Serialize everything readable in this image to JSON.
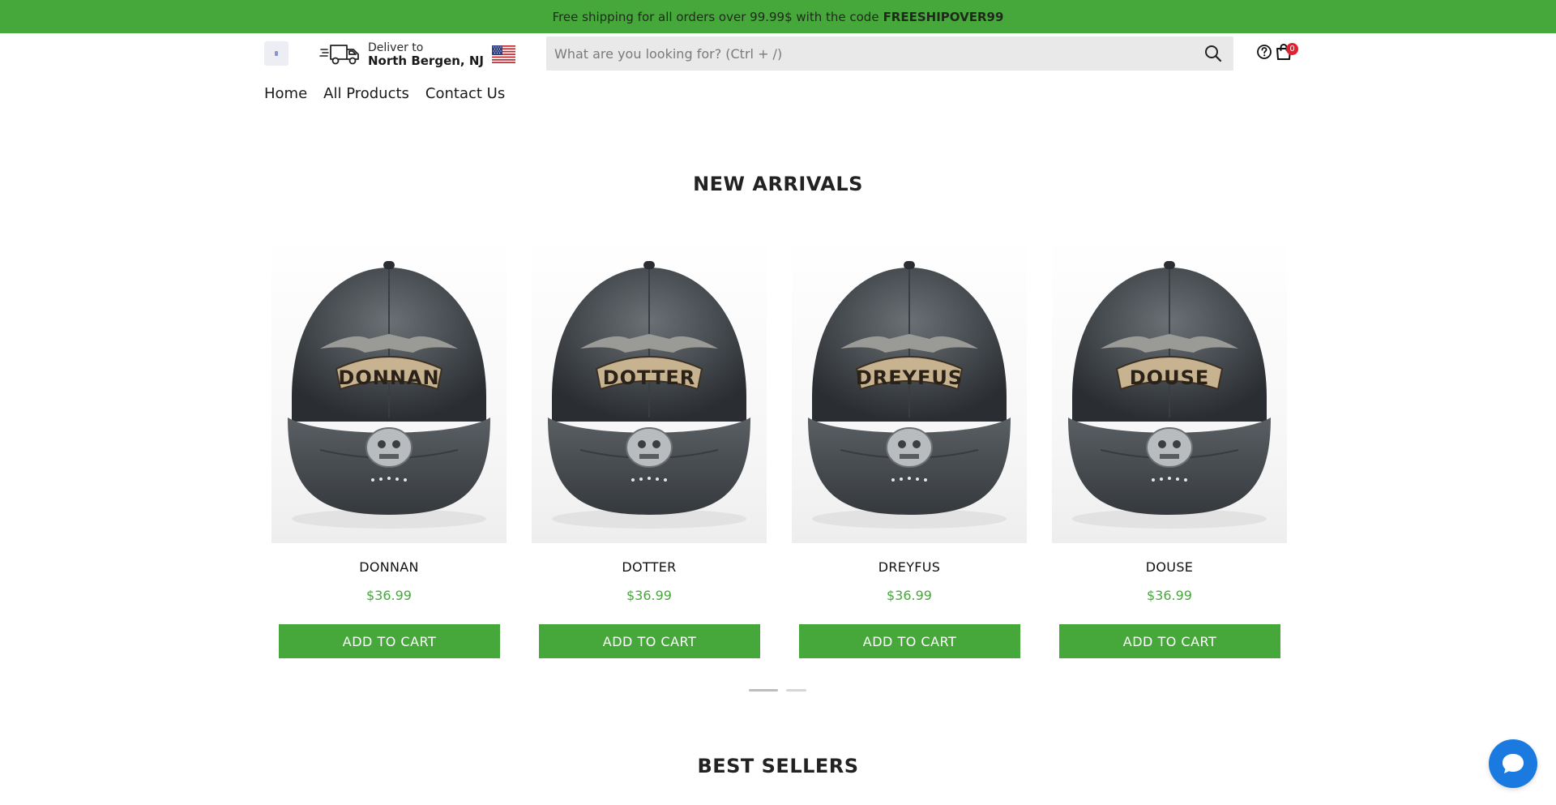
{
  "announcement": {
    "text": "Free shipping for all orders over 99.99$ with the code",
    "code": "FREESHIPOVER99"
  },
  "header": {
    "deliver_label": "Deliver to",
    "deliver_location": "North Bergen, NJ",
    "search_placeholder": "What are you looking for? (Ctrl + /)",
    "cart_count": "0"
  },
  "nav": {
    "items": [
      {
        "label": "Home"
      },
      {
        "label": "All Products"
      },
      {
        "label": "Contact Us"
      }
    ]
  },
  "new_arrivals": {
    "title": "NEW ARRIVALS",
    "products": [
      {
        "name": "DONNAN",
        "cap_text": "DONNAN",
        "price": "$36.99",
        "button": "ADD TO CART"
      },
      {
        "name": "DOTTER",
        "cap_text": "DOTTER",
        "price": "$36.99",
        "button": "ADD TO CART"
      },
      {
        "name": "DREYFUS",
        "cap_text": "DREYFUS",
        "price": "$36.99",
        "button": "ADD TO CART"
      },
      {
        "name": "DOUSE",
        "cap_text": "DOUSE",
        "price": "$36.99",
        "button": "ADD TO CART"
      }
    ],
    "carousel_pages": 2,
    "carousel_active": 1
  },
  "best_sellers": {
    "title": "BEST SELLERS"
  },
  "colors": {
    "brand_green": "#46a83a",
    "badge_red": "#e0212f",
    "chat_blue": "#1a7ae0"
  },
  "icons": [
    "truck-icon",
    "us-flag-icon",
    "search-icon",
    "help-icon",
    "shopping-bag-icon",
    "chat-icon"
  ]
}
